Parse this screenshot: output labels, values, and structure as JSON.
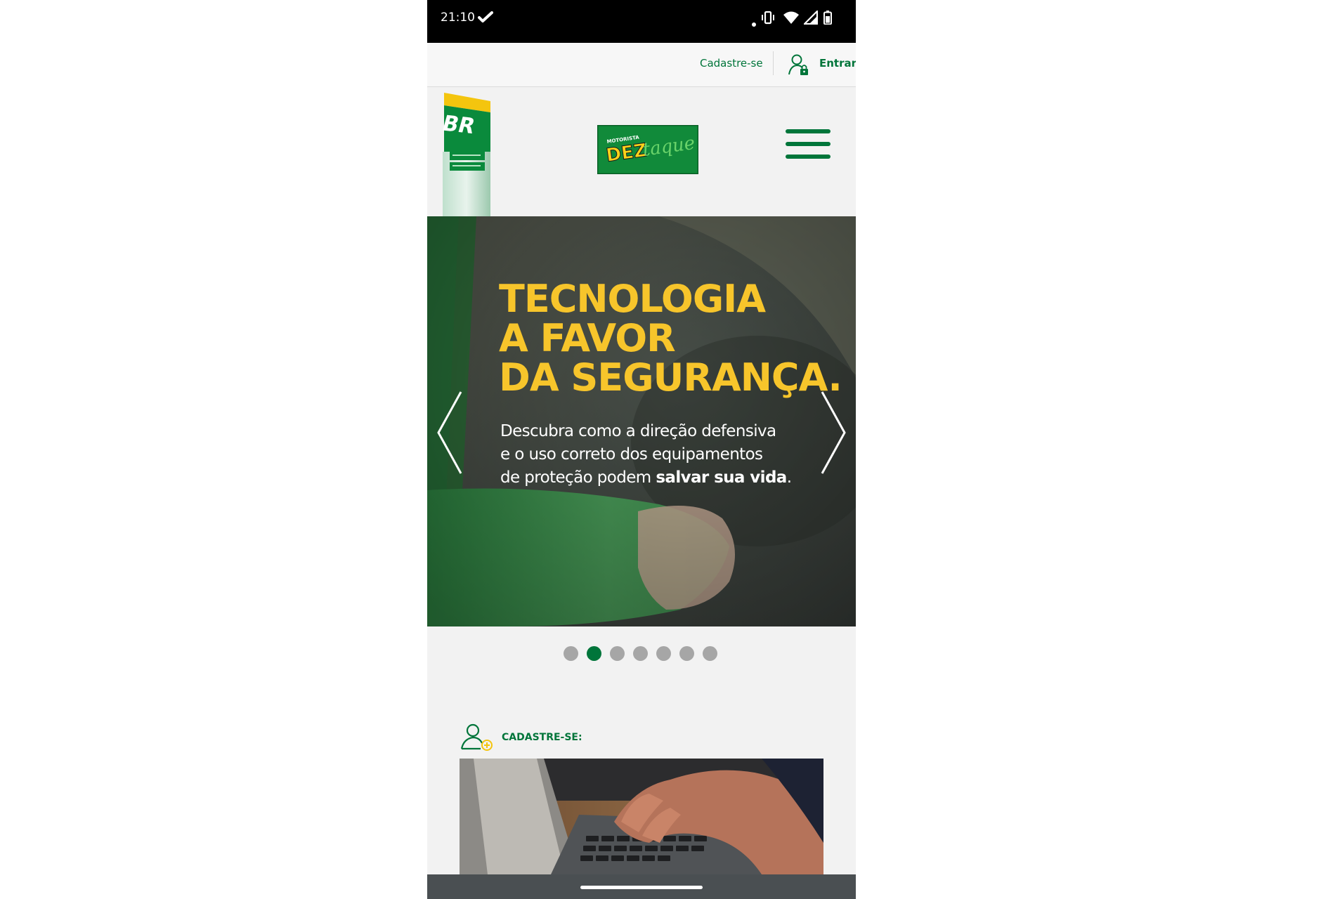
{
  "status_bar": {
    "time": "21:10",
    "icons": [
      "check-icon",
      "dot-icon",
      "vibrate-icon",
      "wifi-icon",
      "signal-icon",
      "battery-icon"
    ]
  },
  "top_bar": {
    "signup_label": "Cadastre-se",
    "login_label": "Entrar",
    "login_icon": "user-lock-icon"
  },
  "header": {
    "br_logo_text": "BR",
    "logo_small_text": "MOTORISTA",
    "logo_main_text": "DEZ",
    "logo_script_text": "taque",
    "menu_icon": "hamburger-icon"
  },
  "hero": {
    "title_lines": [
      "TECNOLOGIA",
      "A FAVOR",
      "DA SEGURANÇA."
    ],
    "description_line1": "Descubra como a direção defensiva",
    "description_line2": "e o uso correto dos equipamentos",
    "description_line3_start": "de proteção podem ",
    "description_line3_bold": "salvar sua vida",
    "description_line3_end": ".",
    "prev_icon": "chevron-left-icon",
    "next_icon": "chevron-right-icon"
  },
  "carousel": {
    "slide_count": 7,
    "active_index": 1
  },
  "signup_section": {
    "title": "CADASTRE-SE:",
    "icon": "user-add-icon"
  },
  "colors": {
    "brand_green": "#00753a",
    "highlight_yellow": "#f7c52b",
    "dot_inactive": "#a6a6a6"
  }
}
